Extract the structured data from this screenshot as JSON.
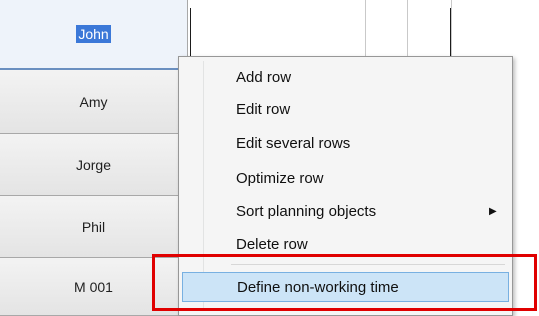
{
  "rows": [
    {
      "label": "John",
      "selected": true
    },
    {
      "label": "Amy"
    },
    {
      "label": "Jorge"
    },
    {
      "label": "Phil"
    },
    {
      "label": "M 001"
    }
  ],
  "context_menu": {
    "items": [
      {
        "label": "Add row"
      },
      {
        "label": "Edit row"
      },
      {
        "label": "Edit several rows"
      },
      {
        "label": "Optimize row"
      },
      {
        "label": "Sort planning objects",
        "submenu_arrow": "▶"
      },
      {
        "label": "Delete row"
      },
      {
        "label": "Define non-working time",
        "highlighted": true
      }
    ]
  },
  "colors": {
    "annotation": "#e00000",
    "highlight": "#cce4f7",
    "selection": "#3b78d8"
  }
}
